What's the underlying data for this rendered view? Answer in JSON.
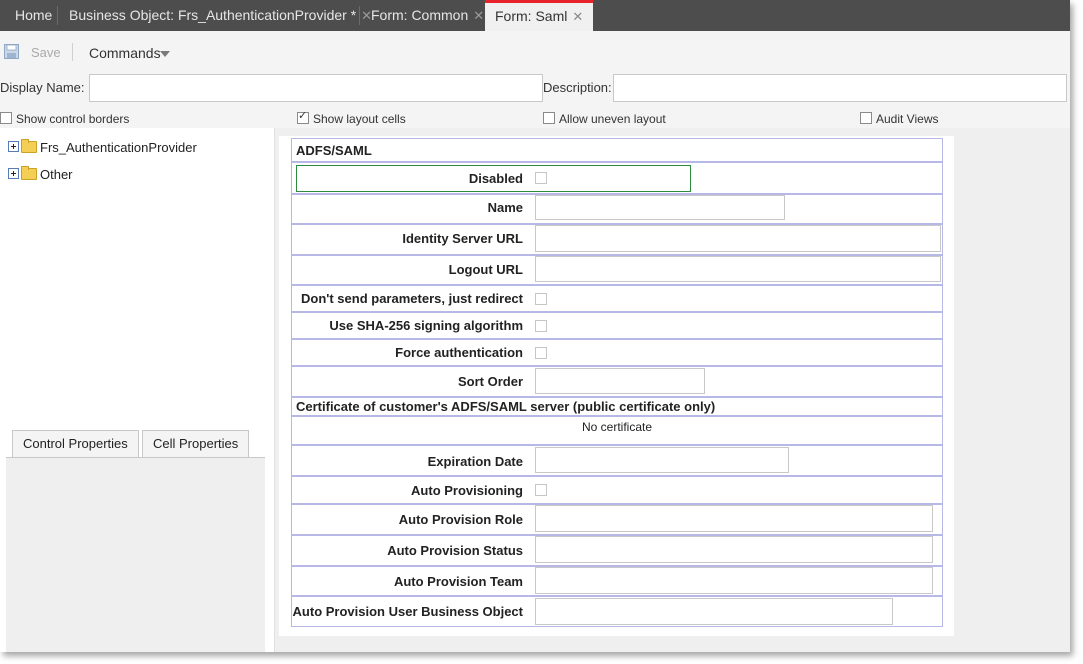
{
  "tabs": [
    {
      "label": "Home",
      "closable": false
    },
    {
      "label": "Business Object: Frs_AuthenticationProvider *",
      "closable": true
    },
    {
      "label": "Form: Common",
      "closable": true
    },
    {
      "label": "Form: Saml",
      "closable": true,
      "active": true
    }
  ],
  "toolbar": {
    "save_label": "Save",
    "commands_label": "Commands"
  },
  "form_header": {
    "display_name_label": "Display Name:",
    "display_name_value": "",
    "description_label": "Description:",
    "description_value": ""
  },
  "options": {
    "show_control_borders": {
      "label": "Show control borders",
      "checked": false
    },
    "show_layout_cells": {
      "label": "Show layout cells",
      "checked": true
    },
    "allow_uneven_layout": {
      "label": "Allow uneven layout",
      "checked": false
    },
    "audit_views": {
      "label": "Audit Views",
      "checked": false
    }
  },
  "tree": [
    "Frs_AuthenticationProvider",
    "Other"
  ],
  "property_tabs": [
    "Control Properties",
    "Cell Properties"
  ],
  "form": {
    "section_title": "ADFS/SAML",
    "fields": {
      "disabled": "Disabled",
      "name": "Name",
      "identity_server_url": "Identity Server URL",
      "logout_url": "Logout URL",
      "dont_send_params": "Don't send parameters, just redirect",
      "sha256": "Use SHA-256 signing algorithm",
      "force_auth": "Force authentication",
      "sort_order": "Sort Order",
      "expiration_date": "Expiration Date",
      "auto_provisioning": "Auto Provisioning",
      "auto_provision_role": "Auto Provision Role",
      "auto_provision_status": "Auto Provision Status",
      "auto_provision_team": "Auto Provision Team",
      "auto_provision_user_bo": "Auto Provision User Business Object"
    },
    "certificate_title": "Certificate of customer's ADFS/SAML server (public certificate only)",
    "certificate_value": "No certificate"
  },
  "colors": {
    "tabbar": "#4d4d4d",
    "active_tab_accent": "#e8222a",
    "cell_border": "#b8b8e6",
    "selected_cell_border": "#2e8b3e"
  }
}
